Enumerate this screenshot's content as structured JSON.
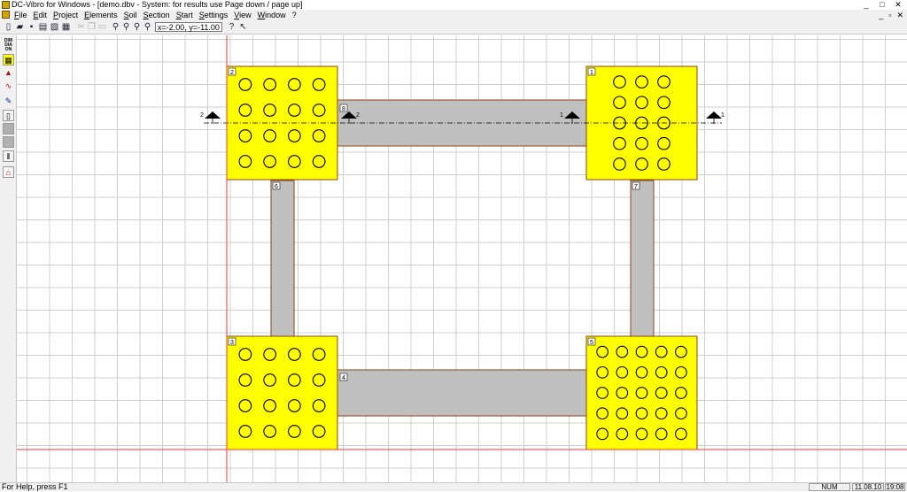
{
  "window": {
    "title": "DC-Vibro for Windows - [demo.dbv - System: for results use Page down / page up]",
    "buttons": [
      "_",
      "□",
      "✕"
    ]
  },
  "menu": {
    "items": [
      "File",
      "Edit",
      "Project",
      "Elements",
      "Soil",
      "Section",
      "Start",
      "Settings",
      "View",
      "Window",
      "?"
    ],
    "mdi_buttons": [
      "_",
      "▫",
      "✕"
    ]
  },
  "toolbar": {
    "coord_display": "x=-2.00, y=-11.00"
  },
  "sidebar": {
    "dim_label": "DIM",
    "dia_label": "DIA",
    "on_label": "ON"
  },
  "drawing": {
    "colors": {
      "foundation": "#ffff00",
      "beam": "#c0c0c0",
      "outline": "#8b4513",
      "grid": "#cfcfcf",
      "axis": "#ff3333"
    },
    "foundations": [
      {
        "id": "1",
        "rows": 5,
        "cols": 3
      },
      {
        "id": "2",
        "rows": 4,
        "cols": 4
      },
      {
        "id": "3",
        "rows": 4,
        "cols": 4
      },
      {
        "id": "5",
        "rows": 5,
        "cols": 5
      }
    ],
    "beams": [
      {
        "id": "8",
        "orientation": "horizontal"
      },
      {
        "id": "4",
        "orientation": "horizontal"
      },
      {
        "id": "6",
        "orientation": "vertical"
      },
      {
        "id": "7",
        "orientation": "vertical"
      }
    ],
    "section_markers": [
      {
        "label": "1"
      },
      {
        "label": "2"
      }
    ]
  },
  "status": {
    "help": "For Help, press F1",
    "num": "NUM",
    "date": "11.08.10",
    "time": "19:08"
  }
}
